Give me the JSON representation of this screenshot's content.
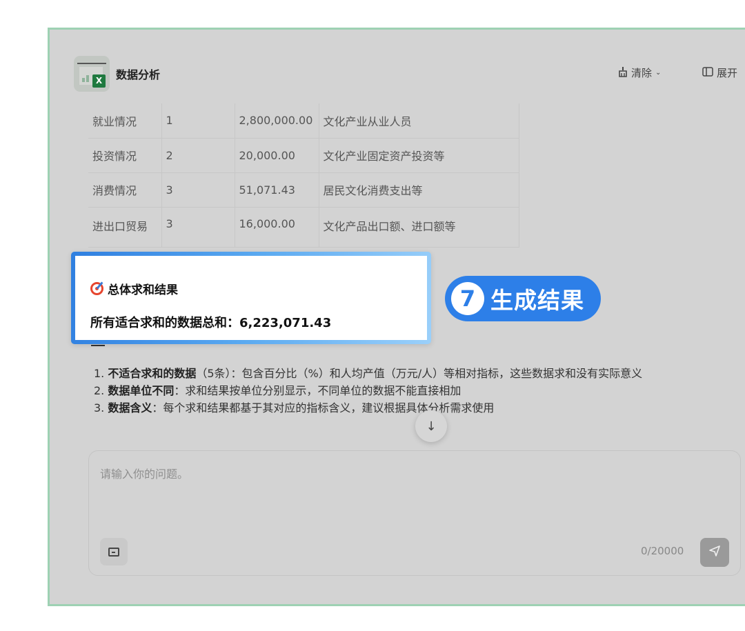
{
  "header": {
    "title": "数据分析",
    "clear_label": "清除",
    "expand_label": "展开"
  },
  "table": {
    "rows": [
      [
        "就业情况",
        "1",
        "2,800,000.00",
        "文化产业从业人员"
      ],
      [
        "投资情况",
        "2",
        "20,000.00",
        "文化产业固定资产投资等"
      ],
      [
        "消费情况",
        "3",
        "51,071.43",
        "居民文化消费支出等"
      ],
      [
        "进出口贸易",
        "3",
        "16,000.00",
        "文化产品出口额、进口额等"
      ]
    ]
  },
  "result_card": {
    "title": "总体求和结果",
    "sum_text": "所有适合求和的数据总和：6,223,071.43"
  },
  "step_badge": {
    "number": "7",
    "label": "生成结果"
  },
  "notes": [
    {
      "prefix": "1. ",
      "bold": "不适合求和的数据",
      "rest": "（5条）：包含百分比（%）和人均产值（万元/人）等相对指标，这些数据求和没有实际意义"
    },
    {
      "prefix": "2. ",
      "bold": "数据单位不同",
      "rest": "：求和结果按单位分别显示，不同单位的数据不能直接相加"
    },
    {
      "prefix": "3. ",
      "bold": "数据含义",
      "rest": "：每个求和结果都基于其对应的指标含义，建议根据具体分析需求使用"
    }
  ],
  "composer": {
    "placeholder": "请输入你的问题。",
    "char_count": "0/20000"
  },
  "colors": {
    "frame_border": "#9ed1b3",
    "accent_blue": "#2d7fe8",
    "target_red": "#e6452e"
  }
}
